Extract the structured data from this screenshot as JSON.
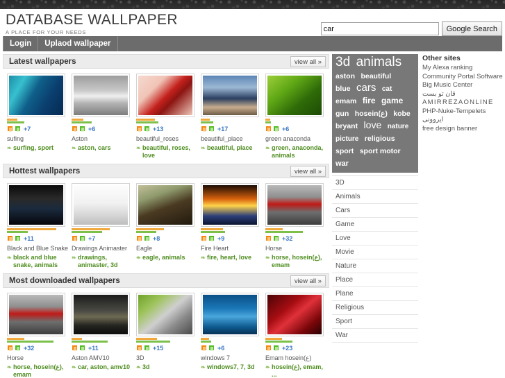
{
  "header": {
    "title": "DATABASE WALLPAPER",
    "tagline": "A PLACE FOR YOUR NEEDS",
    "search": {
      "value": "car",
      "placeholder": "",
      "button_label": "Google Search"
    }
  },
  "nav": {
    "items": [
      {
        "label": "Login"
      },
      {
        "label": "Uplaod wallpaper"
      }
    ]
  },
  "view_all_label": "view all »",
  "tag_icon": "❧",
  "sections": [
    {
      "title": "Latest wallpapers",
      "cards": [
        {
          "title": "sufing",
          "tags": "surfing, sport",
          "count": "+7",
          "bar_orange": 18,
          "bar_green": 30,
          "art": "surf"
        },
        {
          "title": "Aston",
          "tags": "aston, cars",
          "count": "+6",
          "bar_orange": 20,
          "bar_green": 34,
          "art": "car-white"
        },
        {
          "title": "beautiful_roses",
          "tags": "beautiful, roses, love",
          "count": "+13",
          "bar_orange": 32,
          "bar_green": 38,
          "art": "rose"
        },
        {
          "title": "beautiful_place",
          "tags": "beautiful, place",
          "count": "+17",
          "bar_orange": 16,
          "bar_green": 22,
          "art": "place"
        },
        {
          "title": "green anaconda",
          "tags": "green, anaconda, animals",
          "count": "+6",
          "bar_orange": 8,
          "bar_green": 10,
          "art": "lizard"
        }
      ]
    },
    {
      "title": "Hottest wallpapers",
      "cards": [
        {
          "title": "Black and Blue Snake",
          "tags": "black and blue snake, animals",
          "count": "+11",
          "bar_orange": 84,
          "bar_green": 36,
          "art": "snake"
        },
        {
          "title": "Drawings Animaster",
          "tags": "drawings, animaster, 3d",
          "count": "+7",
          "bar_orange": 66,
          "bar_green": 52,
          "art": "drawing"
        },
        {
          "title": "Eagle",
          "tags": "eagle, animals",
          "count": "+8",
          "bar_orange": 48,
          "bar_green": 34,
          "art": "eagle"
        },
        {
          "title": "Fire Heart",
          "tags": "fire, heart, love",
          "count": "+9",
          "bar_orange": 38,
          "bar_green": 42,
          "art": "fire"
        },
        {
          "title": "Horse",
          "tags": "horse, hosein(ع), emam",
          "count": "+32",
          "bar_orange": 30,
          "bar_green": 64,
          "art": "horse"
        }
      ]
    },
    {
      "title": "Most downloaded wallpapers",
      "cards": [
        {
          "title": "Horse",
          "tags": "horse, hosein(ع), emam",
          "count": "+32",
          "bar_orange": 30,
          "bar_green": 80,
          "art": "horse"
        },
        {
          "title": "Aston AMV10",
          "tags": "car, aston, amv10",
          "count": "+11",
          "bar_orange": 18,
          "bar_green": 62,
          "art": "car-dark"
        },
        {
          "title": "3D",
          "tags": "3d",
          "count": "+15",
          "bar_orange": 36,
          "bar_green": 58,
          "art": "robot"
        },
        {
          "title": "windows 7",
          "tags": "windows7, 7, 3d",
          "count": "+6",
          "bar_orange": 14,
          "bar_green": 18,
          "art": "win7"
        },
        {
          "title": "Emam hosein(ع)",
          "tags": "hosein(ع), emam, ...",
          "count": "+23",
          "bar_orange": 28,
          "bar_green": 46,
          "art": "emam"
        }
      ]
    }
  ],
  "tagcloud": [
    {
      "label": "3d",
      "size": 19
    },
    {
      "label": "animals",
      "size": 19
    },
    {
      "label": "aston",
      "size": 10.5
    },
    {
      "label": "beautiful",
      "size": 10.5
    },
    {
      "label": "blue",
      "size": 10.5
    },
    {
      "label": "cars",
      "size": 15
    },
    {
      "label": "cat",
      "size": 10
    },
    {
      "label": "emam",
      "size": 10.5
    },
    {
      "label": "fire",
      "size": 12
    },
    {
      "label": "game",
      "size": 12
    },
    {
      "label": "gun",
      "size": 10.5
    },
    {
      "label": "hosein(ع)",
      "size": 10.5
    },
    {
      "label": "kobe",
      "size": 10.5
    },
    {
      "label": "bryant",
      "size": 10.5
    },
    {
      "label": "love",
      "size": 14
    },
    {
      "label": "nature",
      "size": 10
    },
    {
      "label": "picture",
      "size": 10
    },
    {
      "label": "religious",
      "size": 10.5
    },
    {
      "label": "sport",
      "size": 10.5
    },
    {
      "label": "sport motor",
      "size": 10.5
    },
    {
      "label": "war",
      "size": 11
    }
  ],
  "categories": [
    {
      "label": "3D"
    },
    {
      "label": "Animals"
    },
    {
      "label": "Cars"
    },
    {
      "label": "Game"
    },
    {
      "label": "Love"
    },
    {
      "label": "Movie"
    },
    {
      "label": "Nature"
    },
    {
      "label": "Place"
    },
    {
      "label": "Plane"
    },
    {
      "label": "Religious"
    },
    {
      "label": "Sport"
    },
    {
      "label": "War"
    }
  ],
  "other_sites": {
    "title": "Other sites",
    "links": [
      {
        "label": "My Alexa ranking",
        "style": ""
      },
      {
        "label": "Community Portal Software",
        "style": ""
      },
      {
        "label": "Big Music Center",
        "style": ""
      },
      {
        "label": "قان تو بست",
        "style": "rtl"
      },
      {
        "label": "AMIRREZAONLINE",
        "style": "spaced"
      },
      {
        "label": "PHP-Nuke-Tempelets",
        "style": ""
      },
      {
        "label": "ایروونی",
        "style": "rtl"
      },
      {
        "label": "free design banner",
        "style": ""
      }
    ]
  },
  "colors": {
    "nav_bg": "#6c6c6c",
    "bar_orange": "#f0a83c",
    "bar_green": "#7cc04a",
    "count_blue": "#3b78c3",
    "tag_green": "#4d8c1e",
    "tagcloud_bg": "#787878"
  }
}
